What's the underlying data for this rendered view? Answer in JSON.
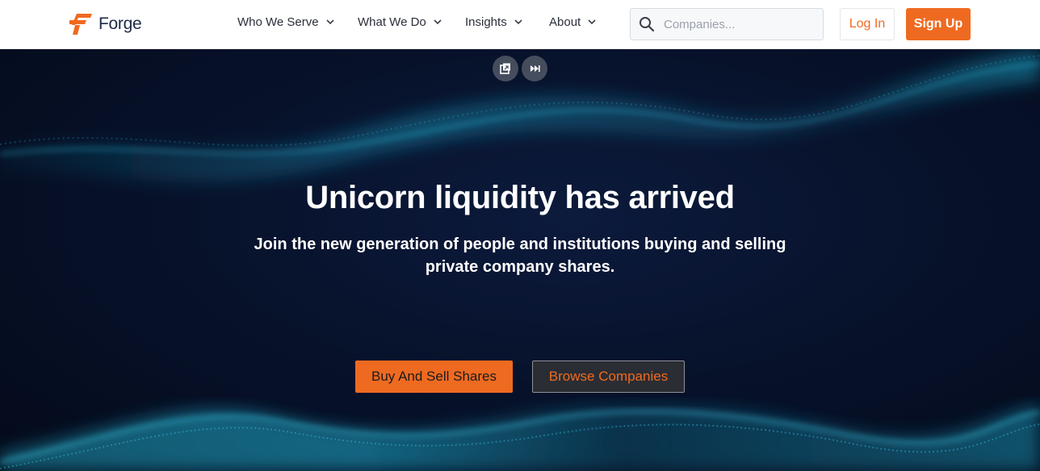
{
  "brand": {
    "name": "Forge",
    "color": "#ef6a21"
  },
  "nav": {
    "items": [
      {
        "label": "Who We Serve",
        "icon": "chevron-down-icon"
      },
      {
        "label": "What We Do",
        "icon": "chevron-down-icon"
      },
      {
        "label": "Insights",
        "icon": "chevron-down-icon"
      },
      {
        "label": "About",
        "icon": "chevron-down-icon"
      }
    ],
    "search": {
      "placeholder": "Companies...",
      "value": "",
      "icon": "search-icon"
    },
    "login_label": "Log In",
    "signup_label": "Sign Up"
  },
  "hero": {
    "media_controls": [
      "picture-in-picture-icon",
      "skip-forward-icon"
    ],
    "title": "Unicorn liquidity has arrived",
    "subtitle": "Join the new generation of people and institutions buying and selling private company shares.",
    "primary_cta": "Buy And Sell Shares",
    "secondary_cta": "Browse Companies",
    "background_color": "#07122b",
    "accent_color": "#1fb3d6"
  }
}
